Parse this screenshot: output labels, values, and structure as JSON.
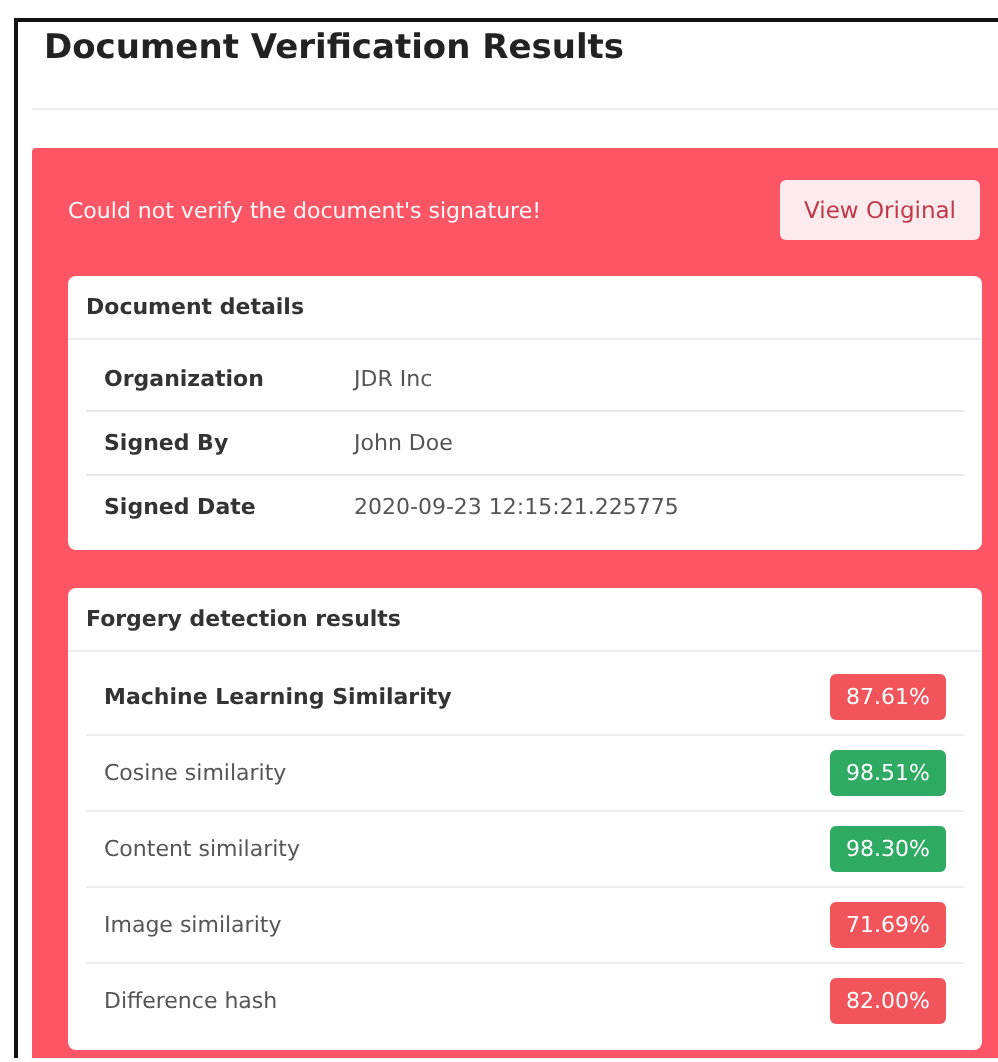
{
  "title": "Document Verification Results",
  "alert": {
    "message": "Could not verify the document's signature!",
    "button": "View Original"
  },
  "details": {
    "title": "Document details",
    "rows": [
      {
        "label": "Organization",
        "value": "JDR Inc"
      },
      {
        "label": "Signed By",
        "value": "John Doe"
      },
      {
        "label": "Signed Date",
        "value": "2020-09-23 12:15:21.225775"
      }
    ]
  },
  "forgery": {
    "title": "Forgery detection results",
    "rows": [
      {
        "kind": "main",
        "label": "Machine Learning Similarity",
        "value": "87.61%",
        "color": "#f2545b"
      },
      {
        "kind": "plain",
        "label": "Cosine similarity",
        "value": "98.51%",
        "color": "#2eaa63"
      },
      {
        "kind": "plain",
        "label": "Content similarity",
        "value": "98.30%",
        "color": "#2eaa63"
      },
      {
        "kind": "plain",
        "label": "Image similarity",
        "value": "71.69%",
        "color": "#f2545b"
      },
      {
        "kind": "plain",
        "label": "Difference hash",
        "value": "82.00%",
        "color": "#f2545b"
      }
    ]
  }
}
